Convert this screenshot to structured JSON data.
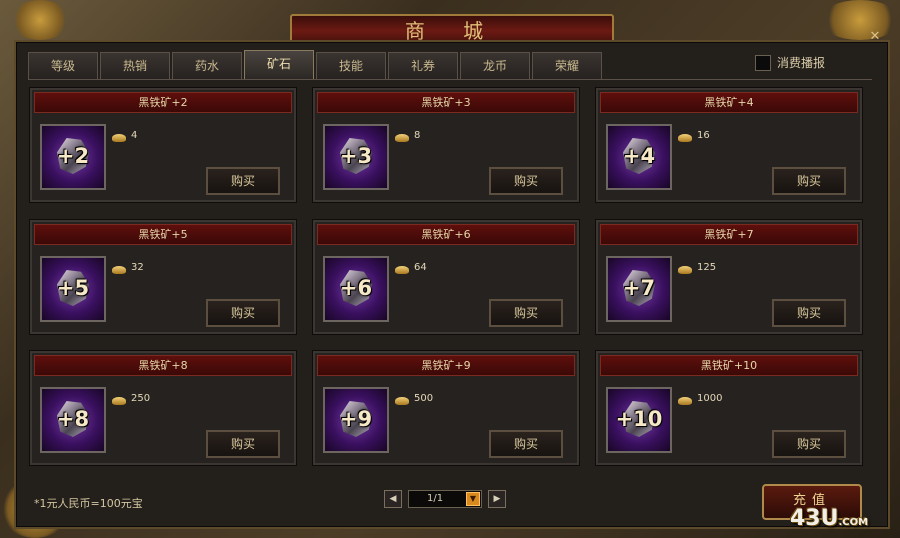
{
  "window": {
    "title": "商 城"
  },
  "tabs": [
    {
      "label": "等级",
      "active": false
    },
    {
      "label": "热销",
      "active": false
    },
    {
      "label": "药水",
      "active": false
    },
    {
      "label": "矿石",
      "active": true
    },
    {
      "label": "技能",
      "active": false
    },
    {
      "label": "礼券",
      "active": false
    },
    {
      "label": "龙币",
      "active": false
    },
    {
      "label": "荣耀",
      "active": false
    }
  ],
  "consume_broadcast": {
    "label": "消费播报",
    "checked": false
  },
  "items": [
    {
      "name": "黑铁矿+2",
      "level": "+2",
      "price": "4",
      "buy_label": "购买"
    },
    {
      "name": "黑铁矿+3",
      "level": "+3",
      "price": "8",
      "buy_label": "购买"
    },
    {
      "name": "黑铁矿+4",
      "level": "+4",
      "price": "16",
      "buy_label": "购买"
    },
    {
      "name": "黑铁矿+5",
      "level": "+5",
      "price": "32",
      "buy_label": "购买"
    },
    {
      "name": "黑铁矿+6",
      "level": "+6",
      "price": "64",
      "buy_label": "购买"
    },
    {
      "name": "黑铁矿+7",
      "level": "+7",
      "price": "125",
      "buy_label": "购买"
    },
    {
      "name": "黑铁矿+8",
      "level": "+8",
      "price": "250",
      "buy_label": "购买"
    },
    {
      "name": "黑铁矿+9",
      "level": "+9",
      "price": "500",
      "buy_label": "购买"
    },
    {
      "name": "黑铁矿+10",
      "level": "+10",
      "price": "1000",
      "buy_label": "购买"
    }
  ],
  "footer": {
    "note": "*1元人民币=100元宝",
    "page": "1/1",
    "recharge_label": "充值",
    "logo_text": "43U",
    "logo_suffix": ".COM"
  },
  "icons": {
    "close": "close-icon",
    "prev": "prev-page-icon",
    "next": "next-page-icon",
    "dropdown": "dropdown-arrow-icon",
    "currency": "gold-ingot-icon",
    "item": "iron-ore-icon"
  },
  "colors": {
    "panel": "#231f1b",
    "header_red": "#5e0f0c",
    "gold_text": "#e2c27a",
    "tab_text": "#c9b98f"
  }
}
